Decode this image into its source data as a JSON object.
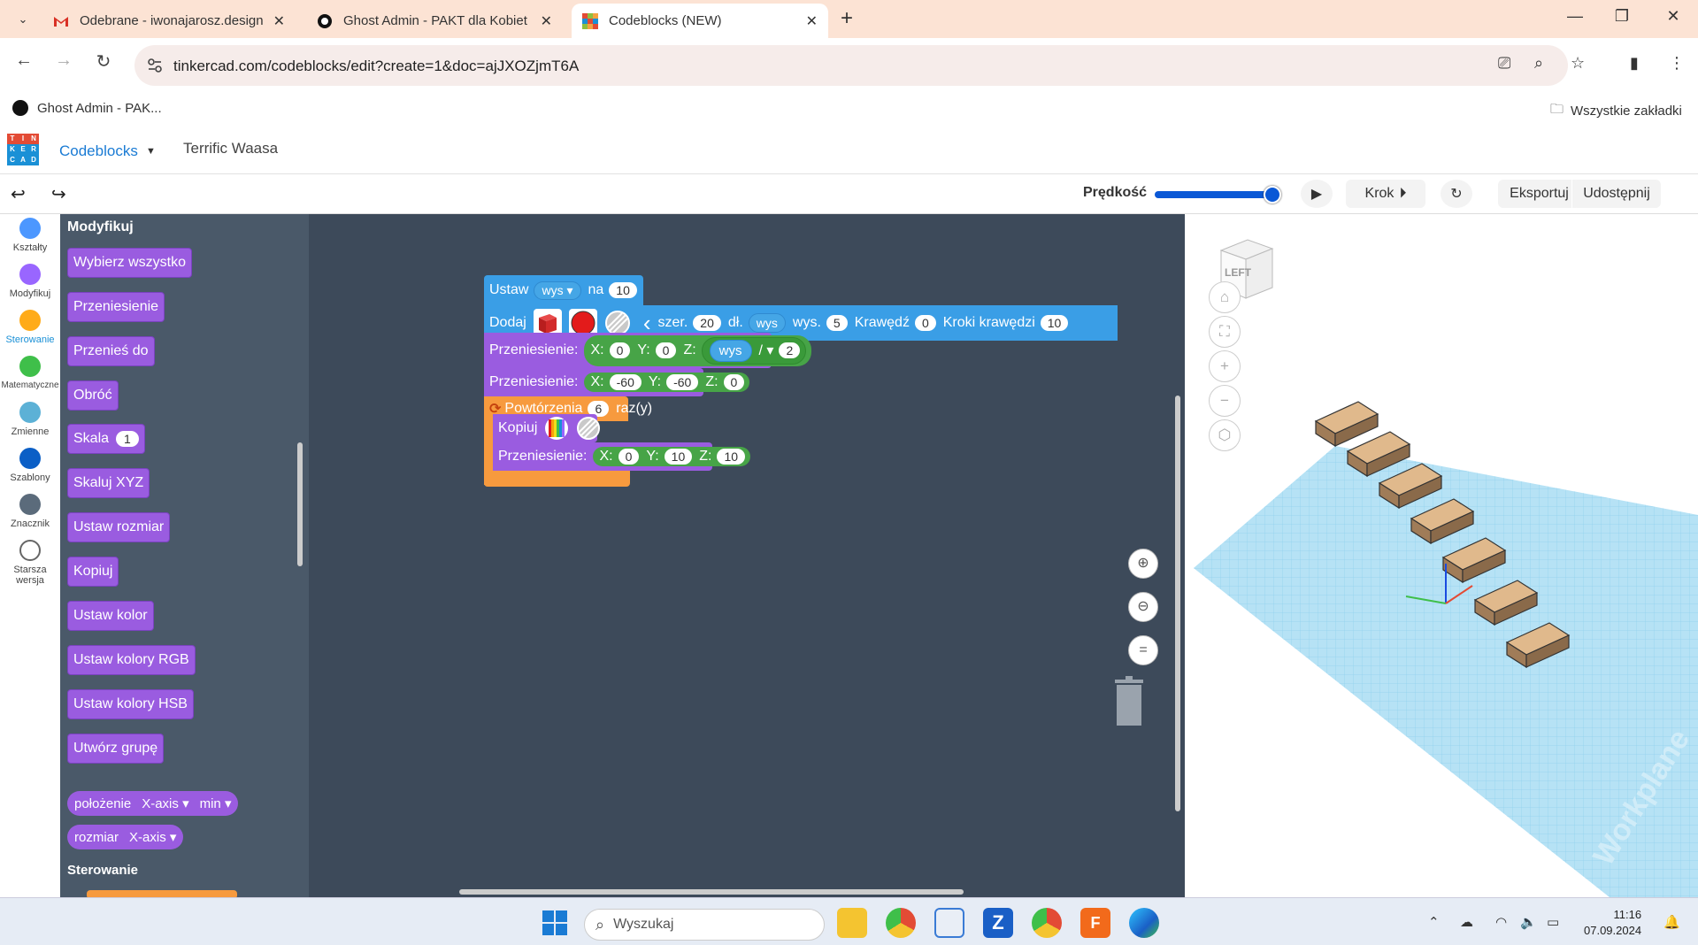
{
  "browser": {
    "tabs": [
      {
        "title": "Odebrane - iwonajarosz.design"
      },
      {
        "title": "Ghost Admin - PAKT dla Kobiet"
      },
      {
        "title": "Codeblocks (NEW)"
      }
    ],
    "url": "tinkercad.com/codeblocks/edit?create=1&doc=ajJXOZjmT6A",
    "bookmarks": {
      "item": "Ghost Admin - PAK...",
      "all": "Wszystkie zakładki"
    }
  },
  "app": {
    "mode": "Codeblocks",
    "project_name": "Terrific Waasa",
    "toolbar": {
      "speed_label": "Prędkość",
      "step_label": "Krok",
      "export_label": "Eksportuj",
      "share_label": "Udostępnij"
    },
    "categories": [
      {
        "label": "Kształty",
        "color": "#4c97ff"
      },
      {
        "label": "Modyfikuj",
        "color": "#9966ff"
      },
      {
        "label": "Sterowanie",
        "color": "#ffab19"
      },
      {
        "label": "Matematyczne",
        "color": "#3fbf4a"
      },
      {
        "label": "Zmienne",
        "color": "#5cb1d6"
      },
      {
        "label": "Szablony",
        "color": "#0b5fc6"
      },
      {
        "label": "Znacznik",
        "color": "#5b6b7b"
      },
      {
        "label": "Starsza wersja",
        "color": "#ffffff"
      }
    ],
    "palette": {
      "heading": "Modyfikuj",
      "blocks": [
        "Wybierz wszystko",
        "Przeniesienie",
        "Przenieś do",
        "Obróć",
        "Skala",
        "Skaluj XYZ",
        "Ustaw rozmiar",
        "Kopiuj",
        "Ustaw kolor",
        "Ustaw kolory RGB",
        "Ustaw kolory HSB",
        "Utwórz grupę"
      ],
      "scale_value": "1",
      "position_block": {
        "label": "położenie",
        "axis": "X-axis",
        "mode": "min"
      },
      "size_block": {
        "label": "rozmiar",
        "axis": "X-axis"
      },
      "next_heading": "Sterowanie"
    },
    "program": {
      "set_var": {
        "label": "Ustaw",
        "var": "wys",
        "to": "na",
        "value": "10"
      },
      "add": {
        "label": "Dodaj",
        "width_label": "szer.",
        "width": "20",
        "length_label": "dł.",
        "length_var": "wys",
        "height_label": "wys.",
        "height": "5",
        "edge_label": "Krawędź",
        "edge": "0",
        "edge_steps_label": "Kroki krawędzi",
        "edge_steps": "10"
      },
      "move1": {
        "label": "Przeniesienie:",
        "x": "0",
        "y": "0",
        "z_var": "wys",
        "op": "/",
        "divisor": "2"
      },
      "move2": {
        "label": "Przeniesienie:",
        "x": "-60",
        "y": "-60",
        "z": "0"
      },
      "repeat": {
        "label": "Powtórzenia",
        "count": "6",
        "suffix": "raz(y)"
      },
      "copy": {
        "label": "Kopiuj"
      },
      "move3": {
        "label": "Przeniesienie:",
        "x": "0",
        "y": "10",
        "z": "10"
      },
      "axis_labels": {
        "x": "X:",
        "y": "Y:",
        "z": "Z:"
      }
    },
    "viewcube_label": "LEFT",
    "workplane_label": "Workplane"
  },
  "taskbar": {
    "search_placeholder": "Wyszukaj",
    "time": "11:16",
    "date": "07.09.2024"
  }
}
